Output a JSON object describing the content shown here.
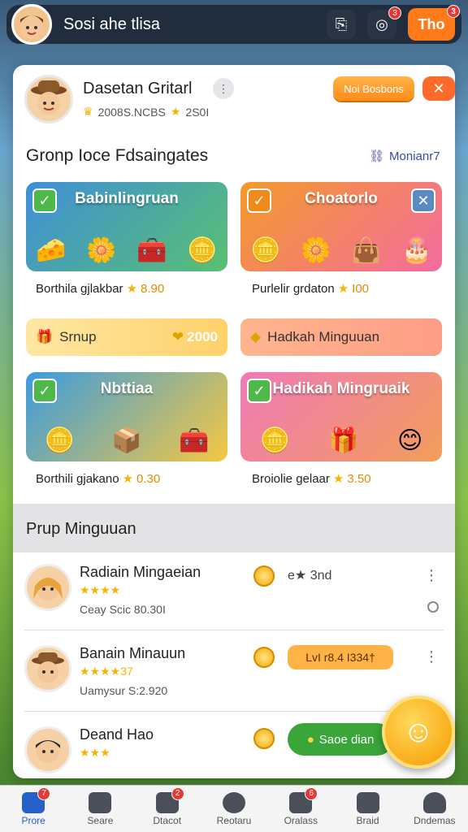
{
  "topbar": {
    "title": "Sosi ahe tlisa",
    "badge_cam": "3",
    "pill_label": "Tho",
    "pill_badge": "3"
  },
  "profile": {
    "name": "Dasetan Gritarl",
    "meta": "2008S.NCBS",
    "score": "2S0I",
    "redeem_label": "Noi Bosbons",
    "close_glyph": "✕"
  },
  "section": {
    "title": "Gronp Ioce Fdsaingates",
    "link": "Monianr7"
  },
  "tiles": [
    {
      "label": "Babinlingruan",
      "caption": "Borthila gjlakbar",
      "points": "8.90",
      "bg": "linear-gradient(135deg,#3f8fd8,#58c071)"
    },
    {
      "label": "Choatorlo",
      "caption": "Purlelir grdaton",
      "points": "I00",
      "bg": "linear-gradient(135deg,#f39a2a,#f46ca0)"
    },
    {
      "label": "Nbttiaa",
      "caption": "Borthili gjakano",
      "points": "0.30",
      "bg": "linear-gradient(135deg,#3a9be0,#f5c842)"
    },
    {
      "label": "Hadikah Mingruaik",
      "caption": "Broiolie gelaar",
      "points": "3.50",
      "bg": "linear-gradient(135deg,#f07ab8,#f29d5a)"
    }
  ],
  "bars": [
    {
      "label": "Srnup",
      "value": "2000"
    },
    {
      "label": "Hadkah Minguuan"
    }
  ],
  "list": {
    "title": "Prup Minguuan",
    "rows": [
      {
        "name": "Radiain Mingaeian",
        "stars": "★★★★",
        "sub": "Ceay Scic 80.30I",
        "extra": "e★ 3nd"
      },
      {
        "name": "Banain Minauun",
        "stars": "★★★★37",
        "sub": "Uamysur S:2.920",
        "amount": "LvI r8.4 I334†"
      },
      {
        "name": "Deand Hao",
        "stars": "★★★",
        "button": "Saoe dian"
      }
    ]
  },
  "nav": [
    {
      "label": "Prore",
      "badge": "7",
      "active": true
    },
    {
      "label": "Seare"
    },
    {
      "label": "Dtacot",
      "badge": "2"
    },
    {
      "label": "Reotaru"
    },
    {
      "label": "Oralass",
      "badge": "6"
    },
    {
      "label": "Braid"
    },
    {
      "label": "Dndemas"
    }
  ]
}
